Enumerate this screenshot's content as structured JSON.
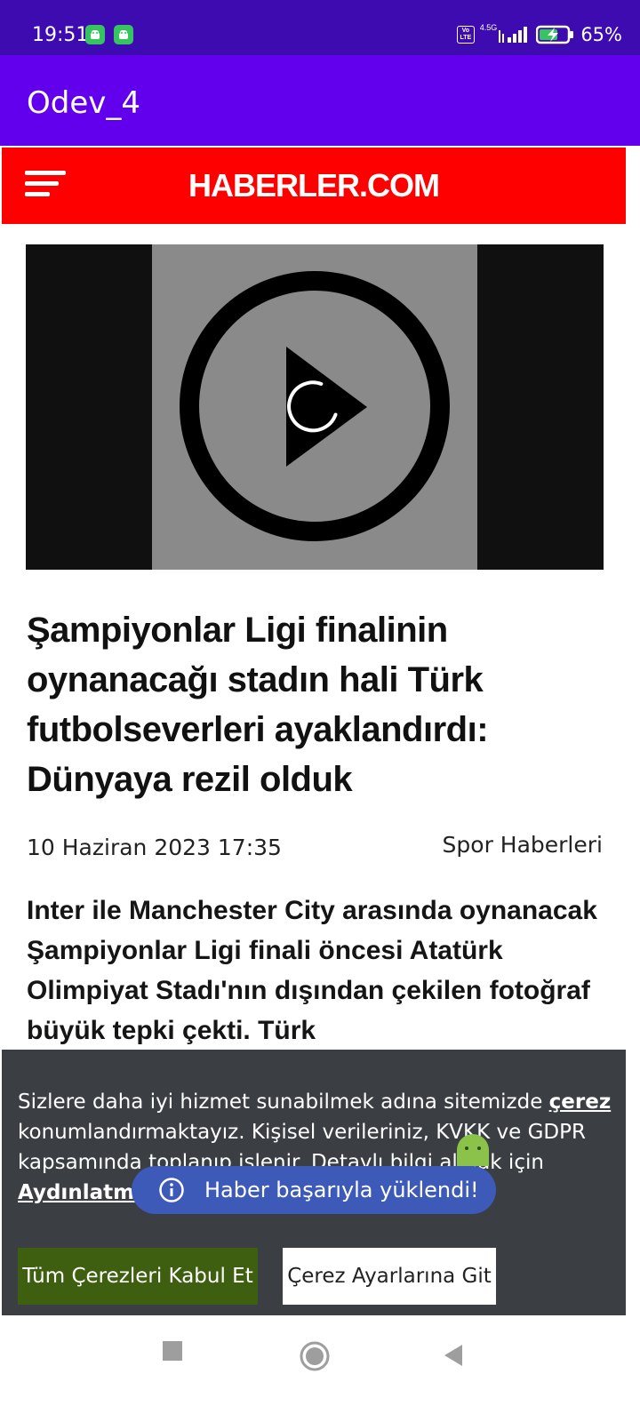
{
  "status_bar": {
    "time": "19:51",
    "network_label": "4.5G",
    "volte_label": "Vo LTE",
    "battery": "65%"
  },
  "app_bar": {
    "title": "Odev_4"
  },
  "site": {
    "logo": "HABERLER.COM",
    "brand_color": "#ff0000"
  },
  "article": {
    "headline": "Şampiyonlar Ligi finalinin oynanacağı stadın hali Türk futbolseverleri ayaklandırdı: Dünyaya rezil olduk",
    "date": "10 Haziran 2023 17:35",
    "category": "Spor Haberleri",
    "summary": "Inter ile Manchester City arasında oynanacak Şampiyonlar Ligi finali öncesi Atatürk Olimpiyat Stadı'nın dışından çekilen fotoğraf büyük tepki çekti. Türk"
  },
  "cookie_banner": {
    "text_part1": "Sizlere daha iyi hizmet sunabilmek adına sitemizde ",
    "cookie_link": "çerez",
    "text_part2": " konumlandırmaktayız. Kişisel verileriniz, KVKK ve GDPR kapsamında toplanıp işlenir. Detaylı bilgi almak için ",
    "policy_link": "Aydınlatma",
    "accept_label": "Tüm Çerezleri Kabul Et",
    "settings_label": "Çerez Ayarlarına Git"
  },
  "toast": {
    "message": "Haber başarıyla yüklendi!"
  },
  "icons": {
    "menu": "hamburger-icon",
    "play": "play-icon",
    "info": "info-icon"
  },
  "colors": {
    "status_bar": "#3d0bb0",
    "app_bar": "#6200ee",
    "accept_button": "#3f5f10",
    "toast": "#3d5ab8"
  }
}
